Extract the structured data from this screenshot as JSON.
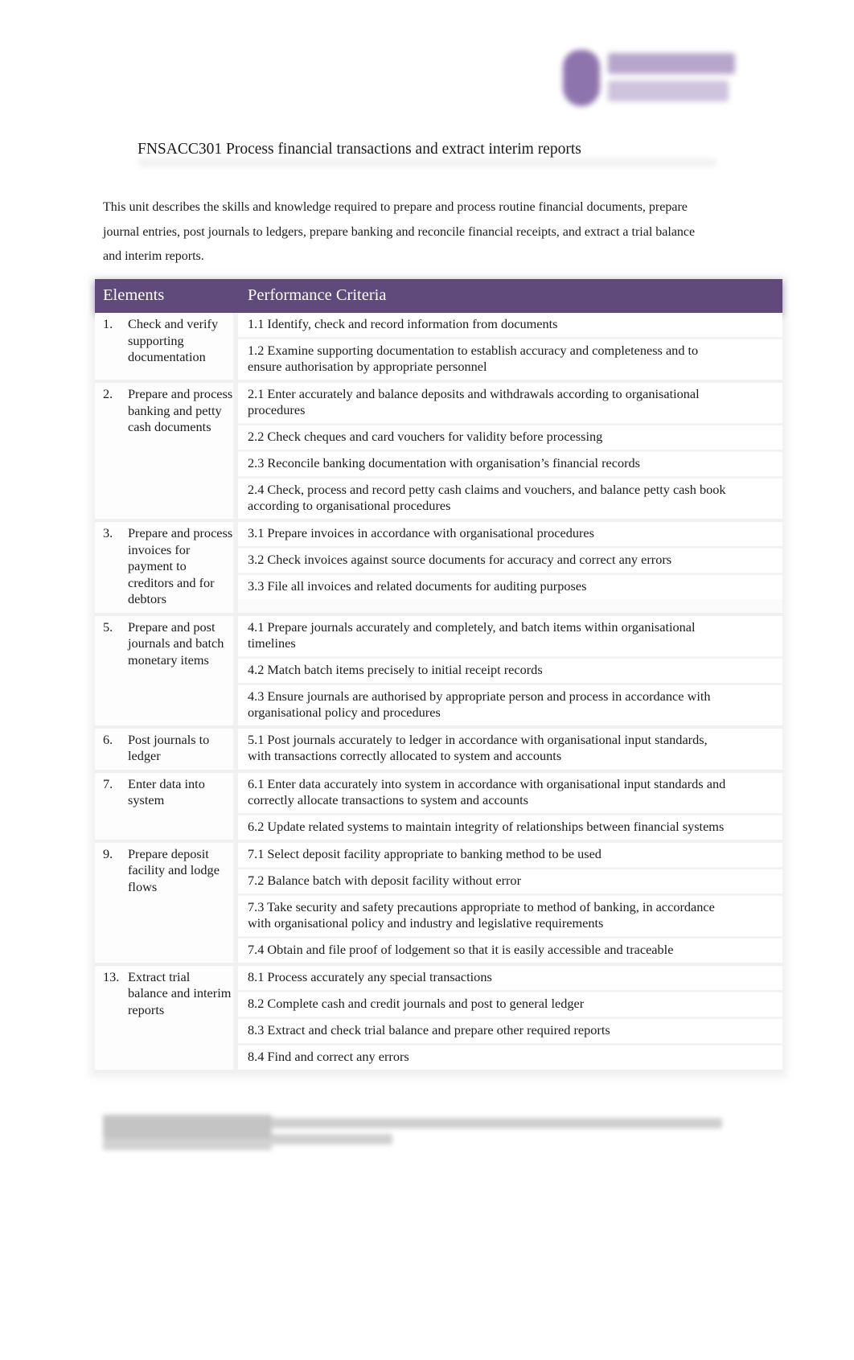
{
  "header": {
    "logo_alt": "Central logo (blurred)",
    "logo_icon": "shield-icon",
    "accent_color": "#5f4a7b"
  },
  "document": {
    "title": "FNSACC301 Process financial transactions and extract interim reports",
    "intro": "This unit describes the skills and knowledge required to prepare and process routine financial documents, prepare journal entries, post journals to ledgers, prepare banking and reconcile financial receipts, and extract a trial balance and interim reports."
  },
  "table": {
    "columns": [
      "Elements",
      "Performance Criteria"
    ],
    "groups": [
      {
        "number": "1.",
        "element": "Check and verify supporting documentation",
        "criteria": [
          "1.1 Identify, check and record information from documents",
          "1.2 Examine supporting documentation to establish accuracy and completeness and to ensure authorisation by appropriate personnel"
        ]
      },
      {
        "number": "2.",
        "element": "Prepare and process banking and petty cash documents",
        "criteria": [
          "2.1 Enter accurately and balance deposits and withdrawals according to organisational procedures",
          "2.2 Check cheques and card vouchers for validity before processing",
          "2.3 Reconcile banking documentation with organisation’s financial records",
          "2.4 Check, process and record petty cash claims and vouchers, and balance petty cash book according to organisational procedures"
        ]
      },
      {
        "number": "3.",
        "element": "Prepare and process invoices for payment to creditors and for debtors",
        "criteria": [
          "3.1 Prepare invoices in accordance with organisational procedures",
          "3.2 Check invoices against source documents for accuracy and correct any errors",
          "3.3 File all invoices and related documents for auditing purposes"
        ]
      },
      {
        "number": "5.",
        "element": "Prepare and post journals and batch monetary items",
        "criteria": [
          "4.1 Prepare journals accurately and completely, and batch items within organisational timelines",
          "4.2 Match batch items precisely to initial receipt records",
          "4.3 Ensure journals are authorised by appropriate person and process in accordance with organisational policy and procedures"
        ]
      },
      {
        "number": "6.",
        "element": "Post journals to ledger",
        "criteria": [
          "5.1 Post journals accurately to ledger in accordance with organisational input standards, with transactions correctly allocated to system and accounts"
        ]
      },
      {
        "number": "7.",
        "element": "Enter data into system",
        "criteria": [
          "6.1 Enter data accurately into system in accordance with organisational input standards and correctly allocate transactions to system and accounts",
          "6.2 Update related systems to maintain integrity of relationships between financial systems"
        ]
      },
      {
        "number": "9.",
        "element": "Prepare deposit facility and lodge flows",
        "criteria": [
          "7.1 Select deposit facility appropriate to banking method to be used",
          "7.2 Balance batch with deposit facility without error",
          "7.3 Take security and safety precautions appropriate to method of banking, in accordance with organisational policy and industry and legislative requirements",
          "7.4 Obtain and file proof of lodgement so that it is easily accessible and traceable"
        ]
      },
      {
        "number": "13.",
        "element": "Extract trial balance and interim reports",
        "criteria": [
          "8.1 Process accurately any special transactions",
          "8.2 Complete cash and credit journals and post to general ledger",
          "8.3 Extract and check trial balance and prepare other required reports",
          "8.4 Find and correct any errors"
        ]
      }
    ]
  },
  "footer": {
    "text": "[blurred footer text – illegible]"
  }
}
